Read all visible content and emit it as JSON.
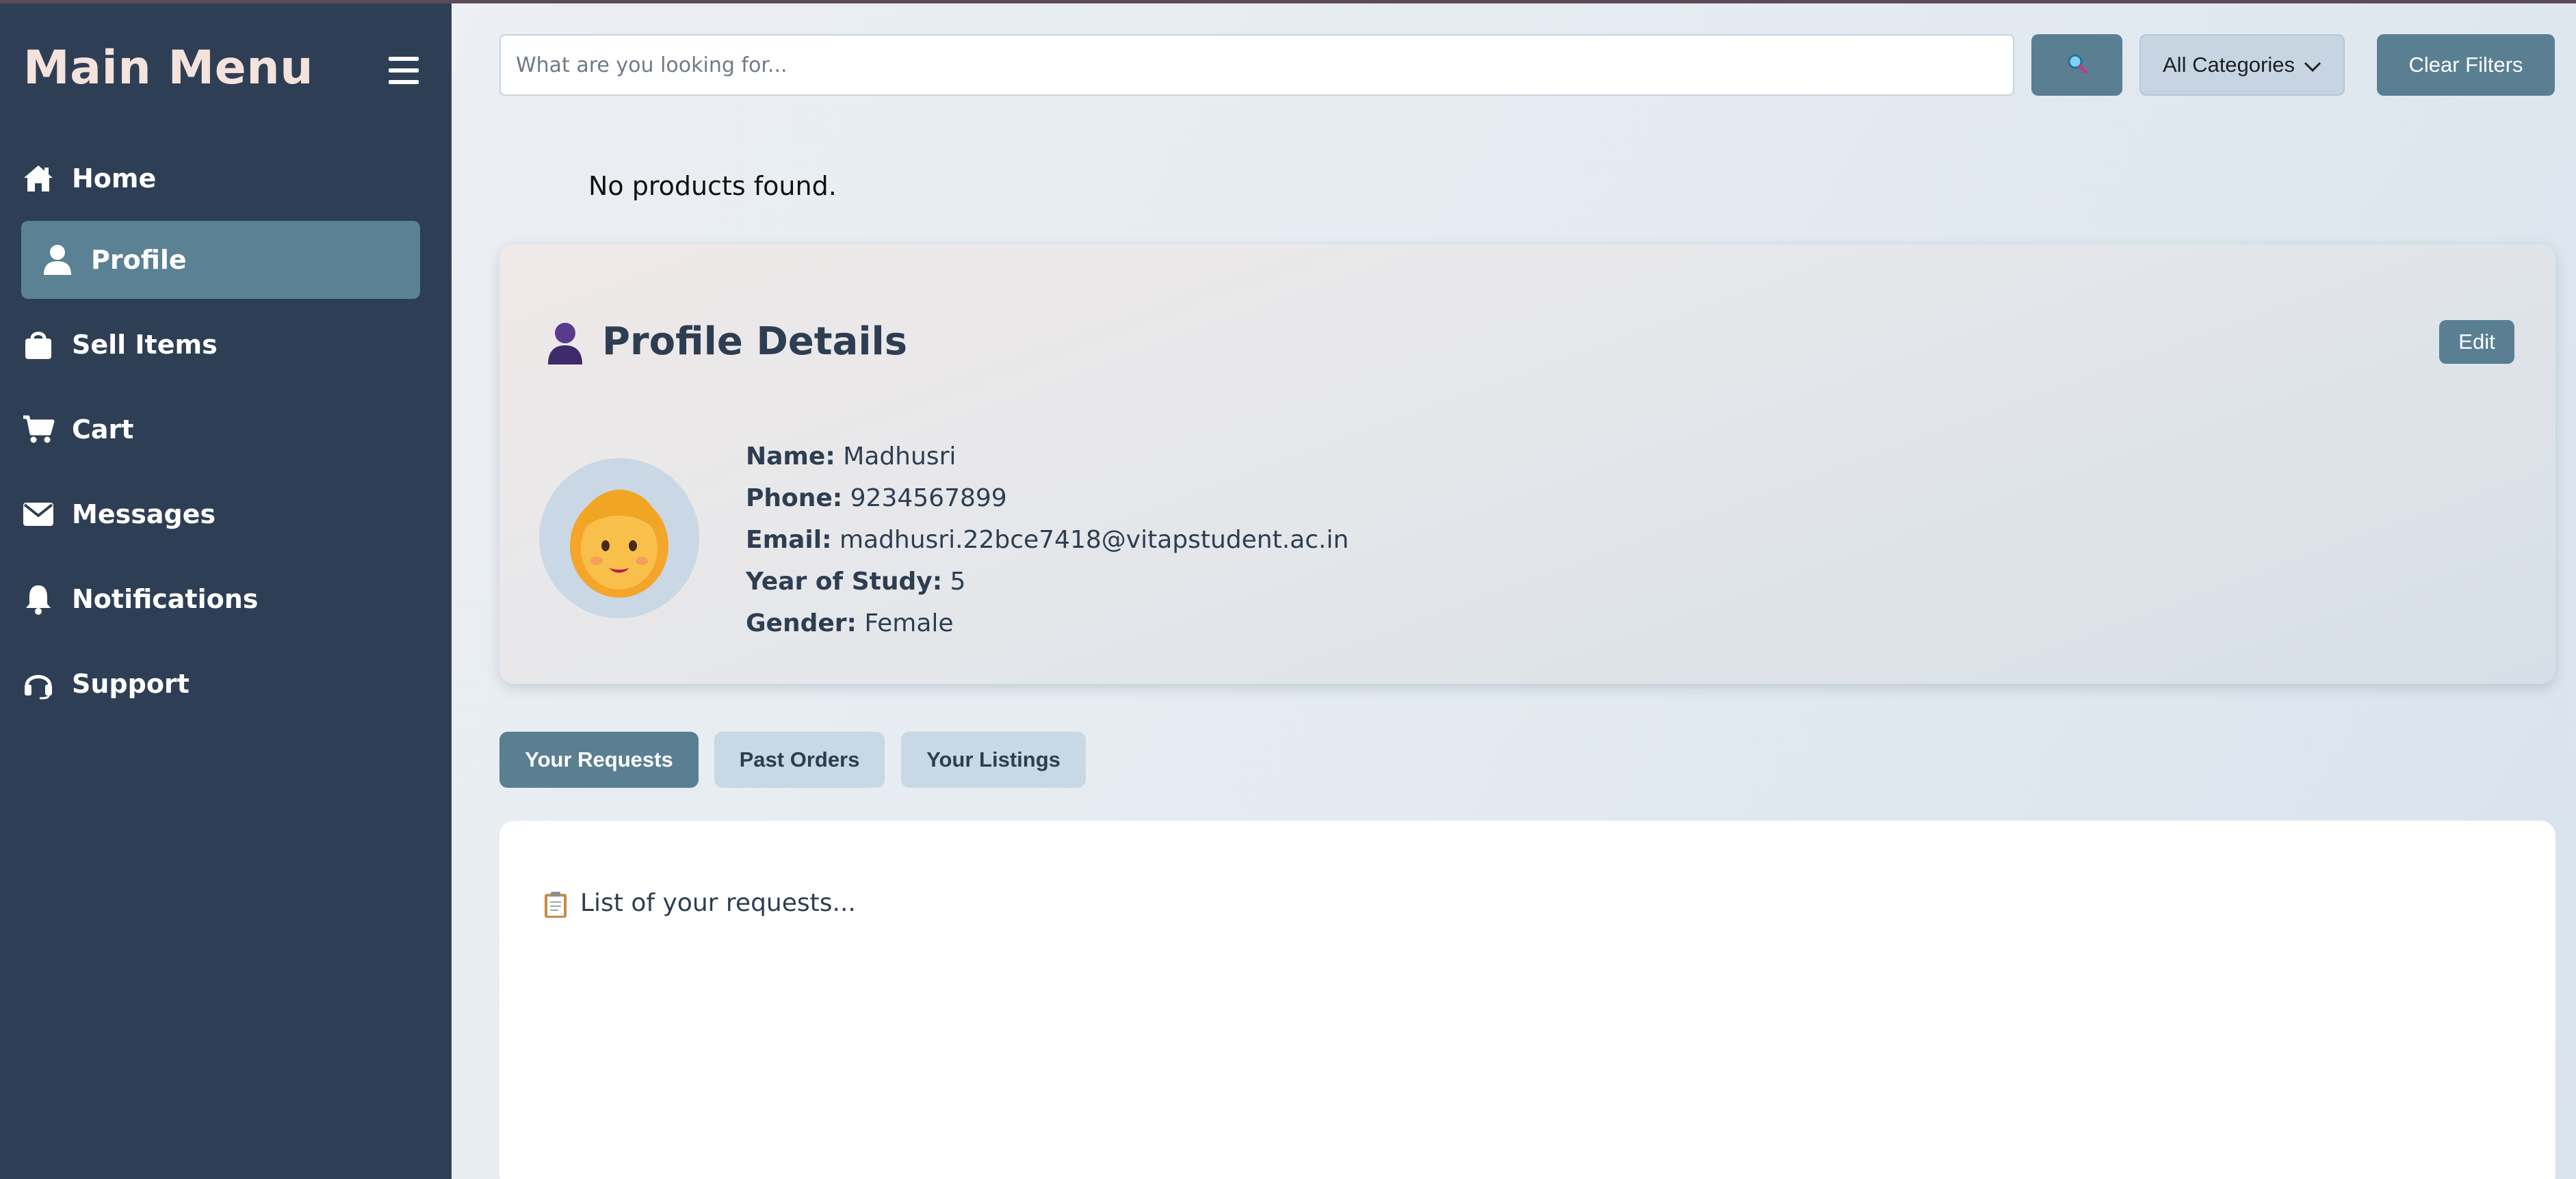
{
  "sidebar": {
    "title": "Main Menu",
    "items": [
      {
        "label": "Home",
        "icon": "home-icon"
      },
      {
        "label": "Profile",
        "icon": "user-icon",
        "active": true
      },
      {
        "label": "Sell Items",
        "icon": "shopping-bag-icon"
      },
      {
        "label": "Cart",
        "icon": "cart-icon"
      },
      {
        "label": "Messages",
        "icon": "envelope-icon"
      },
      {
        "label": "Notifications",
        "icon": "bell-icon"
      },
      {
        "label": "Support",
        "icon": "headset-icon"
      }
    ]
  },
  "search": {
    "placeholder": "What are you looking for...",
    "value": ""
  },
  "category_select": {
    "selected": "All Categories"
  },
  "clear_filters_label": "Clear Filters",
  "no_products_text": "No products found.",
  "profile": {
    "title": "Profile Details",
    "edit_label": "Edit",
    "fields": [
      {
        "label": "Name:",
        "value": "Madhusri"
      },
      {
        "label": "Phone:",
        "value": "9234567899"
      },
      {
        "label": "Email:",
        "value": "madhusri.22bce7418@vitapstudent.ac.in"
      },
      {
        "label": "Year of Study:",
        "value": "5"
      },
      {
        "label": "Gender:",
        "value": "Female"
      }
    ]
  },
  "tabs": [
    {
      "label": "Your Requests",
      "active": true
    },
    {
      "label": "Past Orders",
      "active": false
    },
    {
      "label": "Your Listings",
      "active": false
    }
  ],
  "content": {
    "text": "List of your requests...",
    "icon": "clipboard-icon"
  },
  "colors": {
    "sidebar_bg": "#2e3f55",
    "accent": "#5a7f92",
    "title_text": "#2d3e52",
    "tab_inactive": "#c8d8e4"
  }
}
